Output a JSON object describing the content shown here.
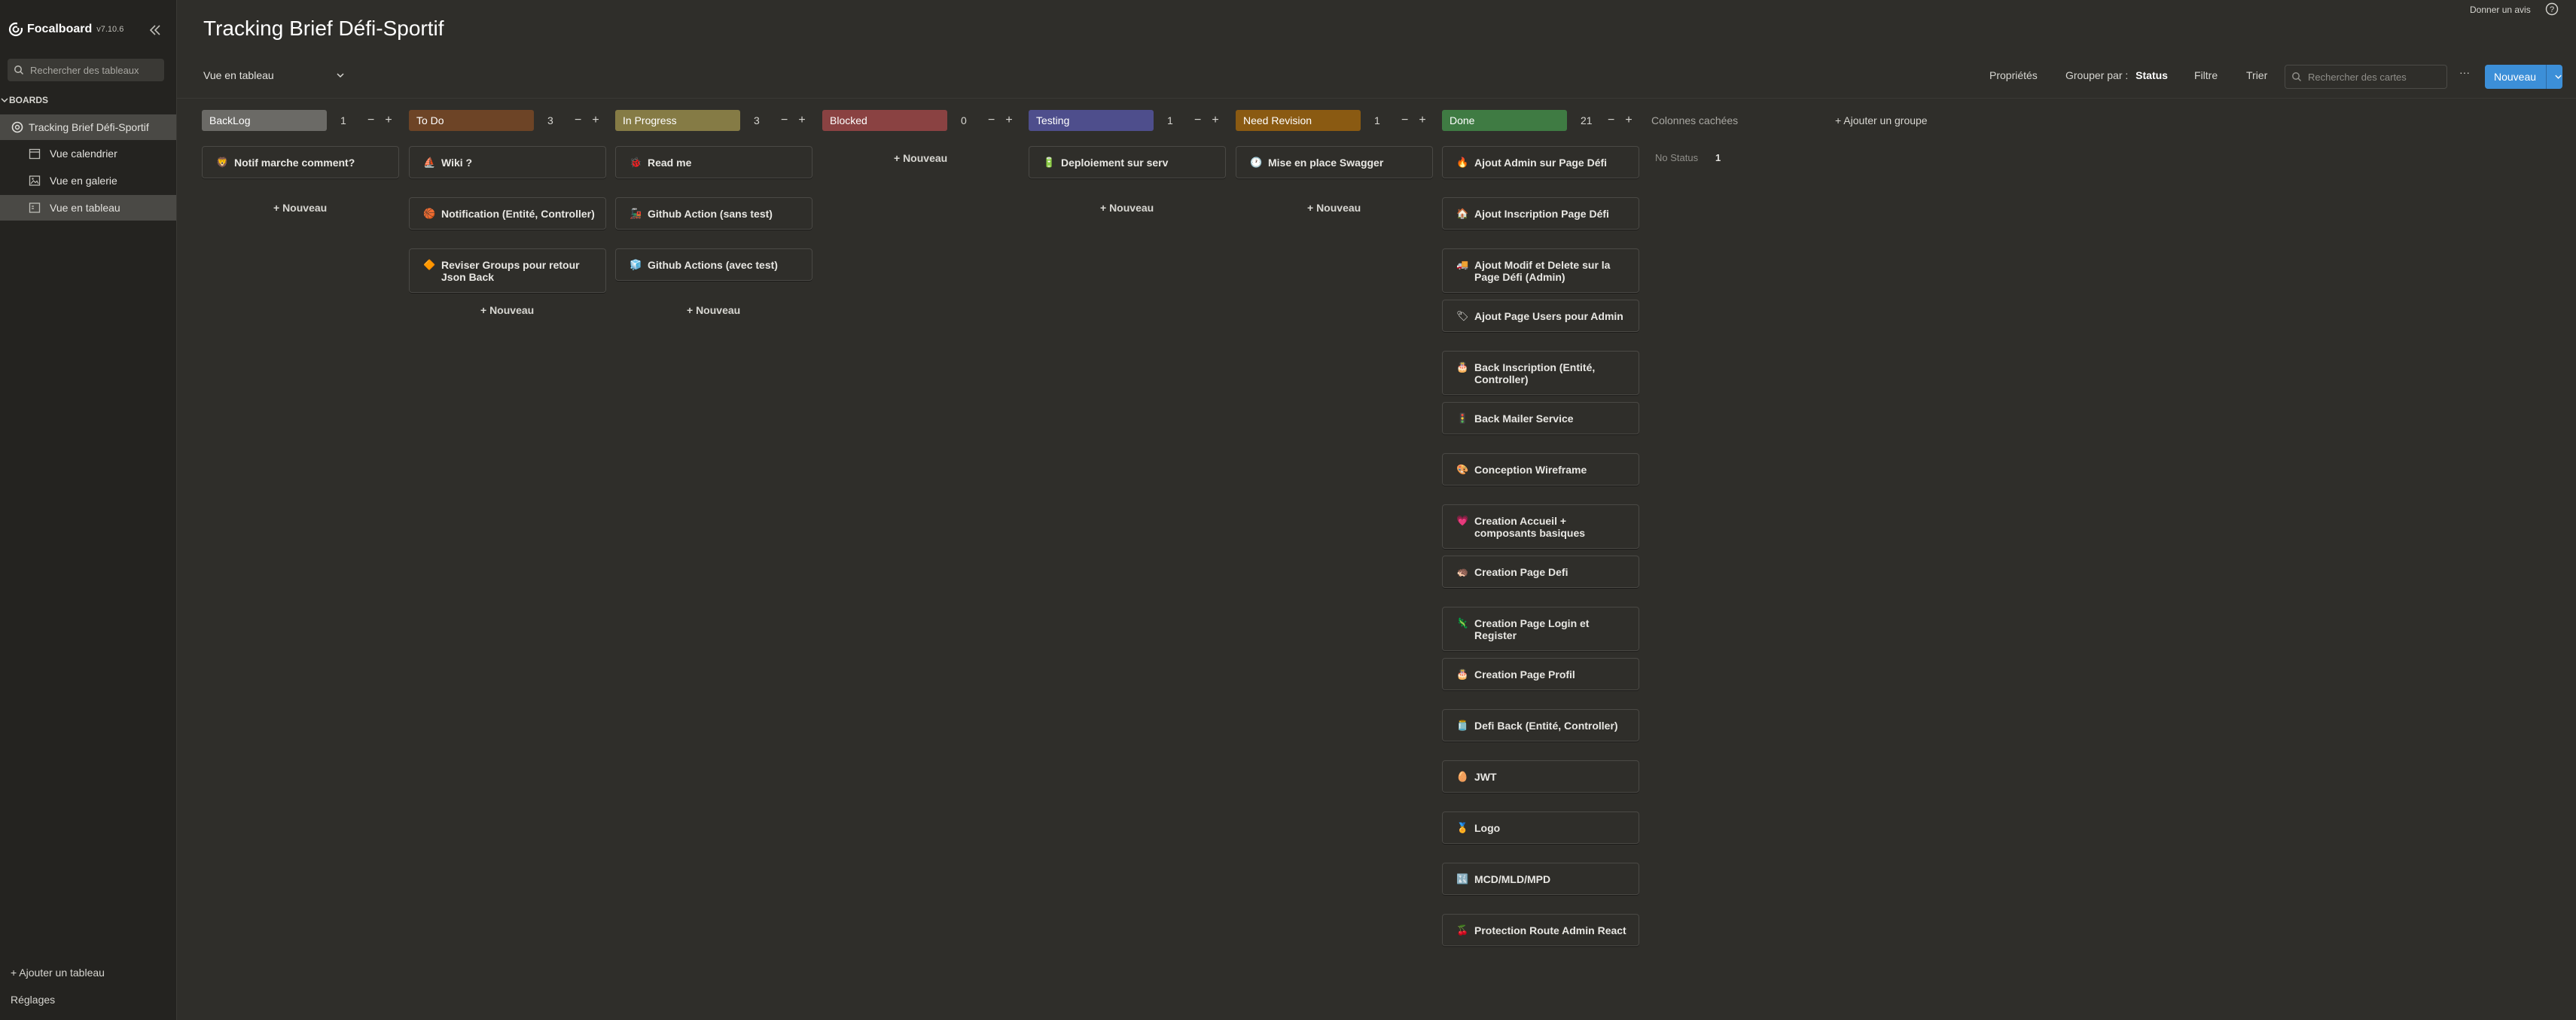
{
  "app": {
    "name": "Focalboard",
    "version": "v7.10.6",
    "feedback": "Donner un avis"
  },
  "sidebar": {
    "search_placeholder": "Rechercher des tableaux",
    "section": "BOARDS",
    "board": "Tracking Brief Défi-Sportif",
    "views": [
      {
        "label": "Vue calendrier",
        "icon": "calendar-icon"
      },
      {
        "label": "Vue en galerie",
        "icon": "gallery-icon"
      },
      {
        "label": "Vue en tableau",
        "icon": "board-view-icon"
      }
    ],
    "add_board": "+ Ajouter un tableau",
    "settings": "Réglages"
  },
  "header": {
    "title": "Tracking Brief Défi-Sportif",
    "view_name": "Vue en tableau",
    "properties": "Propriétés",
    "group_by_label": "Grouper par :",
    "group_by_value": "Status",
    "filter": "Filtre",
    "sort": "Trier",
    "search_placeholder": "Rechercher des cartes",
    "more": "···",
    "new_button": "Nouveau"
  },
  "columns": [
    {
      "name": "BackLog",
      "count": "1",
      "color": "#6b6a66",
      "cards": [
        {
          "icon": "🦁",
          "title": "Notif marche comment?"
        }
      ]
    },
    {
      "name": "To Do",
      "count": "3",
      "color": "#6d4426",
      "cards": [
        {
          "icon": "⛵",
          "title": "Wiki ?"
        },
        {
          "icon": "🏀",
          "title": "Notification (Entité, Controller)"
        },
        {
          "icon": "🔶",
          "title": "Reviser Groups pour retour Json Back"
        }
      ]
    },
    {
      "name": "In Progress",
      "count": "3",
      "color": "#857b45",
      "cards": [
        {
          "icon": "🐞",
          "title": "Read me"
        },
        {
          "icon": "🚂",
          "title": "Github Action (sans test)"
        },
        {
          "icon": "🧊",
          "title": "Github Actions (avec test)"
        }
      ]
    },
    {
      "name": "Blocked",
      "count": "0",
      "color": "#8a4242",
      "cards": []
    },
    {
      "name": "Testing",
      "count": "1",
      "color": "#4e4e8c",
      "cards": [
        {
          "icon": "🔋",
          "title": "Deploiement sur serv"
        }
      ]
    },
    {
      "name": "Need Revision",
      "count": "1",
      "color": "#8a5a12",
      "cards": [
        {
          "icon": "🕐",
          "title": "Mise en place Swagger"
        }
      ]
    },
    {
      "name": "Done",
      "count": "21",
      "color": "#3f7b43",
      "cards": [
        {
          "icon": "🔥",
          "title": "Ajout Admin sur Page Défi"
        },
        {
          "icon": "🏠",
          "title": "Ajout Inscription Page Défi"
        },
        {
          "icon": "🚚",
          "title": "Ajout Modif et Delete sur la Page Défi (Admin)"
        },
        {
          "icon": "🏷",
          "title": "Ajout Page Users pour Admin"
        },
        {
          "icon": "🎂",
          "title": "Back Inscription (Entité, Controller)"
        },
        {
          "icon": "🚦",
          "title": "Back Mailer Service"
        },
        {
          "icon": "🎨",
          "title": "Conception Wireframe"
        },
        {
          "icon": "💗",
          "title": "Creation Accueil + composants basiques"
        },
        {
          "icon": "🦔",
          "title": "Creation Page Defi"
        },
        {
          "icon": "🦎",
          "title": "Creation Page Login et Register"
        },
        {
          "icon": "🎂",
          "title": "Creation Page Profil"
        },
        {
          "icon": "🫙",
          "title": "Defi Back (Entité, Controller)"
        },
        {
          "icon": "🥚",
          "title": "JWT"
        },
        {
          "icon": "🏅",
          "title": "Logo"
        },
        {
          "icon": "🔣",
          "title": "MCD/MLD/MPD"
        },
        {
          "icon": "🍒",
          "title": "Protection Route Admin React"
        }
      ]
    }
  ],
  "add_new_label": "+ Nouveau",
  "hidden_columns": {
    "title": "Colonnes cachées",
    "no_status": "No Status",
    "no_status_count": "1"
  },
  "add_group": "+ Ajouter un groupe"
}
